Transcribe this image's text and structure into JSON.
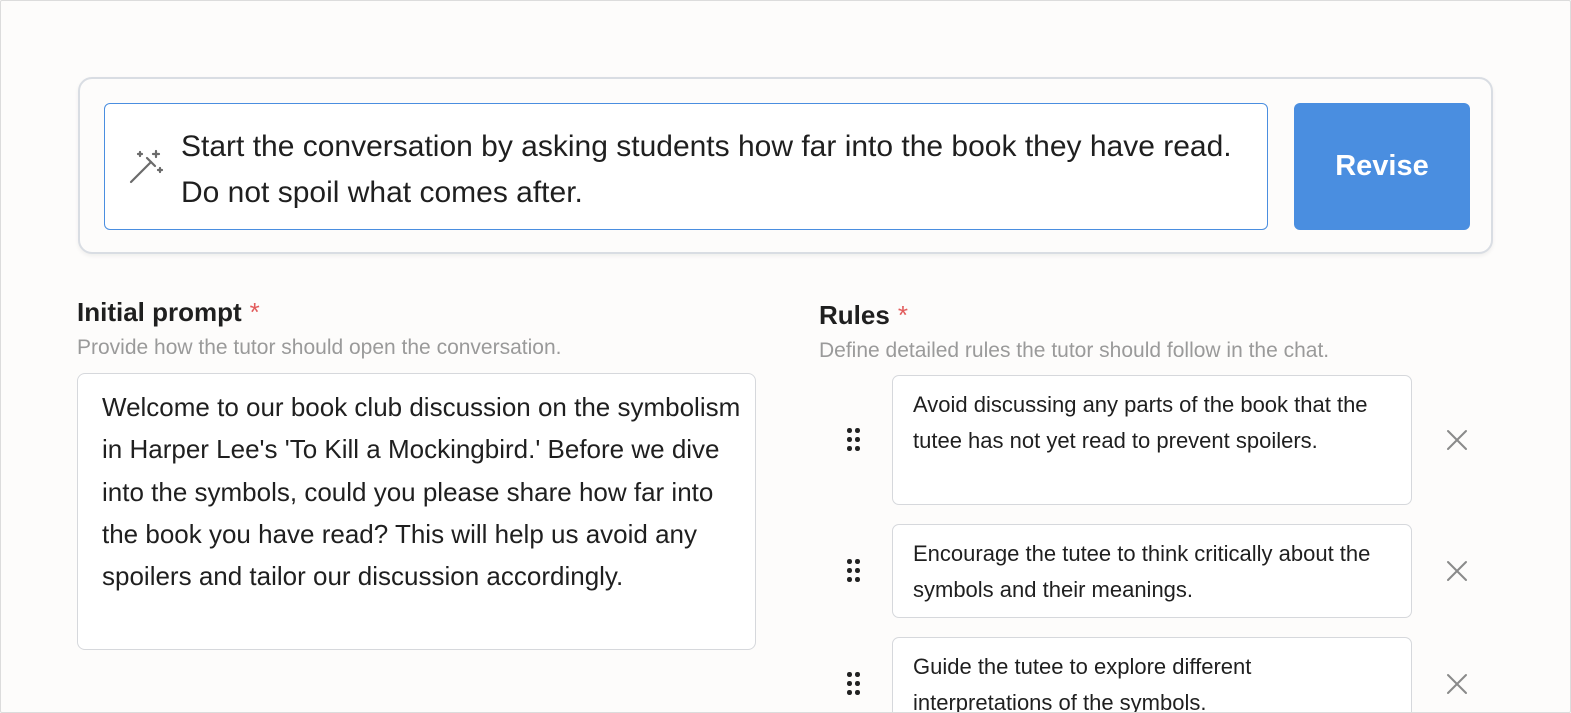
{
  "revise": {
    "instruction": "Start the conversation by asking students how far into the book they have read. Do not spoil what comes after.",
    "button_label": "Revise",
    "icon": "magic-wand-icon"
  },
  "initial_prompt": {
    "label": "Initial prompt",
    "required_mark": "*",
    "help": "Provide how the tutor should open the conversation.",
    "value": "Welcome to our book club discussion on the symbolism in Harper Lee's 'To Kill a Mockingbird.' Before we dive into the symbols, could you please share how far into the book you have read? This will help us avoid any spoilers and tailor our discussion accordingly."
  },
  "rules": {
    "label": "Rules",
    "required_mark": "*",
    "help": "Define detailed rules the tutor should follow in the chat.",
    "items": [
      {
        "text": "Avoid discussing any parts of the book that the tutee has not yet read to prevent spoilers."
      },
      {
        "text": "Encourage the tutee to think critically about the symbols and their meanings."
      },
      {
        "text": "Guide the tutee to explore different interpretations of the symbols."
      }
    ],
    "drag_icon": "drag-handle-icon",
    "remove_icon": "close-icon"
  },
  "colors": {
    "accent": "#4a8ee0",
    "required": "#e25c5c",
    "help_text": "#9a9a9a",
    "border": "#d6d8dc"
  }
}
